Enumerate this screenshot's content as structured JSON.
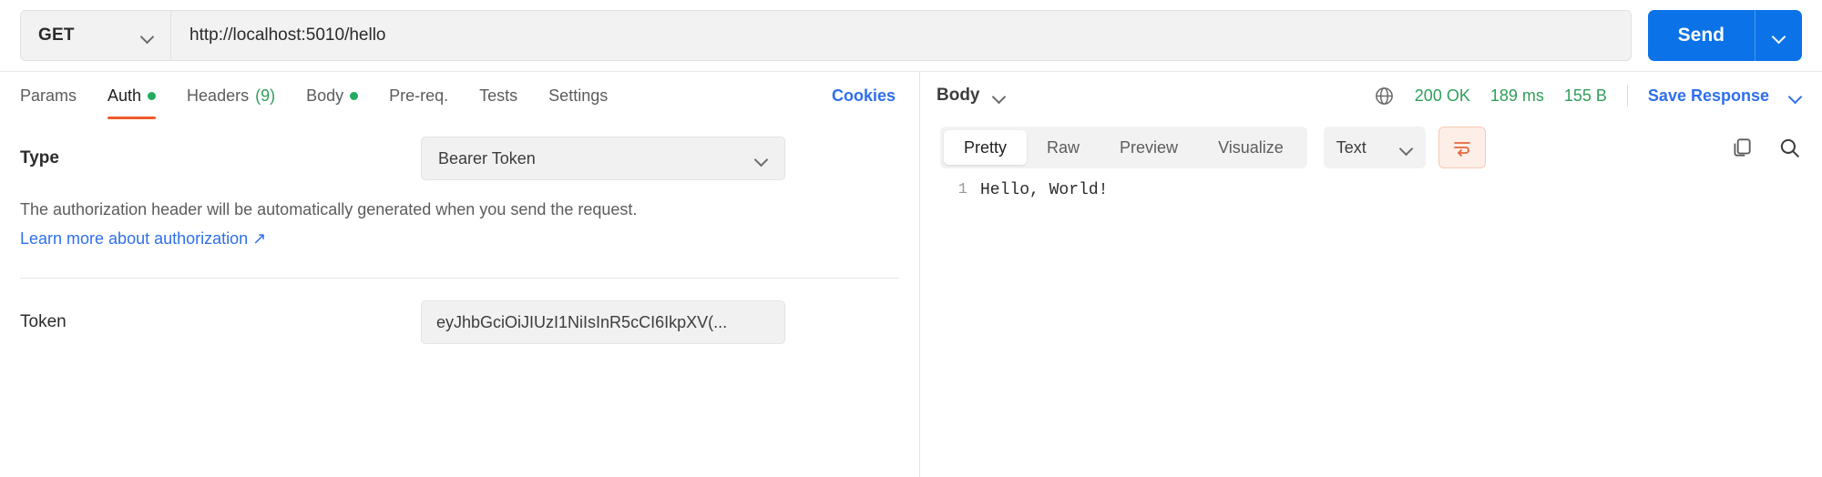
{
  "request": {
    "method": "GET",
    "url_value": "http://localhost:5010/hello",
    "url_placeholder": "Enter URL or paste text",
    "send_label": "Send",
    "send_caret_icon": "chevron-down-icon",
    "method_caret_icon": "chevron-down-icon"
  },
  "request_tabs": [
    {
      "label": "Params",
      "badge": "",
      "dot": false,
      "active": false
    },
    {
      "label": "Auth",
      "badge": "",
      "dot": true,
      "active": true
    },
    {
      "label": "Headers",
      "badge": "(9)",
      "dot": false,
      "active": false
    },
    {
      "label": "Body",
      "badge": "",
      "dot": true,
      "active": false
    },
    {
      "label": "Pre-req.",
      "badge": "",
      "dot": false,
      "active": false
    },
    {
      "label": "Tests",
      "badge": "",
      "dot": false,
      "active": false
    },
    {
      "label": "Settings",
      "badge": "",
      "dot": false,
      "active": false
    }
  ],
  "cookies_link": "Cookies",
  "auth": {
    "type_label": "Type",
    "type_value": "Bearer Token",
    "description": "The authorization header will be automatically generated when you send the request.",
    "learn_more": "Learn more about authorization ↗",
    "token_label": "Token",
    "token_value": "eyJhbGciOiJIUzI1NiIsInR5cCI6IkpXV(...",
    "token_placeholder": "Token"
  },
  "response": {
    "body_menu_label": "Body",
    "status": "200 OK",
    "time": "189 ms",
    "size": "155 B",
    "save_response": "Save Response",
    "globe_icon": "globe-icon",
    "save_caret_icon": "chevron-down-icon",
    "view_tabs": [
      {
        "label": "Pretty",
        "active": true
      },
      {
        "label": "Raw",
        "active": false
      },
      {
        "label": "Preview",
        "active": false
      },
      {
        "label": "Visualize",
        "active": false
      }
    ],
    "format_value": "Text",
    "wrap_icon": "wrap-lines-icon",
    "copy_icon": "copy-icon",
    "search_icon": "search-icon",
    "lines": [
      {
        "number": "1",
        "text": "Hello, World!"
      }
    ]
  },
  "colors": {
    "accent_blue": "#0b72e7",
    "link_blue": "#2f6fed",
    "status_green": "#2f9e5a",
    "dot_green": "#21ac5f",
    "active_tab_underline": "#f15a2b"
  }
}
